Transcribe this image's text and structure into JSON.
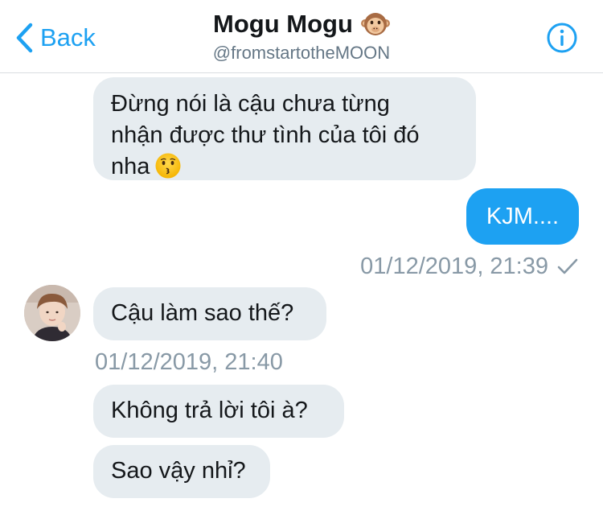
{
  "header": {
    "back_label": "Back",
    "title": "Mogu Mogu",
    "handle": "@fromstartotheMOON",
    "title_emoji": "monkey-face-icon",
    "info_icon": "info-icon"
  },
  "colors": {
    "accent": "#1da1f2",
    "incoming_bubble": "#e6ecf0",
    "timestamp": "#8899a6",
    "text": "#14171a"
  },
  "messages": [
    {
      "direction": "incoming",
      "lines": [
        "Đừng nói là cậu chưa từng",
        "nhận được thư tình của tôi đó",
        "nha"
      ],
      "emoji": "kissing-face-icon"
    },
    {
      "direction": "outgoing",
      "text": "KJM....",
      "timestamp": "01/12/2019, 21:39",
      "status_icon": "checkmark-icon"
    },
    {
      "direction": "incoming",
      "text": "Cậu làm sao thế?",
      "timestamp": "01/12/2019, 21:40"
    },
    {
      "direction": "incoming",
      "text": "Không trả lời tôi à?"
    },
    {
      "direction": "incoming",
      "text": "Sao vậy nhỉ?"
    }
  ]
}
